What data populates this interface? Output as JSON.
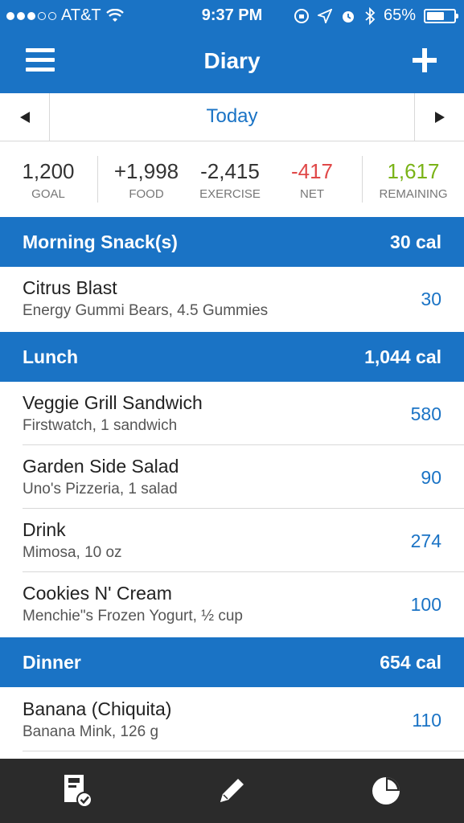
{
  "status_bar": {
    "carrier": "AT&T",
    "time": "9:37 PM",
    "battery": "65%",
    "battery_level": 0.65,
    "signal_bars": 3,
    "signal_total": 5,
    "icons": [
      "wifi-icon",
      "screen-rotation-lock-icon",
      "location-icon",
      "alarm-icon",
      "bluetooth-icon",
      "battery-icon"
    ]
  },
  "nav": {
    "title": "Diary",
    "left_icon": "hamburger-menu-icon",
    "right_icon": "plus-icon"
  },
  "date_bar": {
    "label": "Today"
  },
  "summary": {
    "goal": {
      "value": "1,200",
      "label": "GOAL"
    },
    "food": {
      "value": "+1,998",
      "label": "FOOD"
    },
    "exercise": {
      "value": "-2,415",
      "label": "EXERCISE"
    },
    "net": {
      "value": "-417",
      "label": "NET"
    },
    "remaining": {
      "value": "1,617",
      "label": "REMAINING"
    }
  },
  "sections": [
    {
      "title": "Morning Snack(s)",
      "total": "30 cal",
      "items": [
        {
          "name": "Citrus Blast",
          "desc": "Energy Gummi Bears, 4.5 Gummies",
          "cal": "30"
        }
      ]
    },
    {
      "title": "Lunch",
      "total": "1,044 cal",
      "items": [
        {
          "name": "Veggie Grill Sandwich",
          "desc": "Firstwatch, 1 sandwich",
          "cal": "580"
        },
        {
          "name": "Garden Side Salad",
          "desc": "Uno's Pizzeria, 1 salad",
          "cal": "90"
        },
        {
          "name": "Drink",
          "desc": "Mimosa, 10 oz",
          "cal": "274"
        },
        {
          "name": "Cookies N' Cream",
          "desc": "Menchie\"s Frozen Yogurt, ½ cup",
          "cal": "100"
        }
      ]
    },
    {
      "title": "Dinner",
      "total": "654 cal",
      "items": [
        {
          "name": "Banana (Chiquita)",
          "desc": "Banana Mink, 126 g",
          "cal": "110"
        }
      ]
    }
  ],
  "tab_bar": {
    "tabs": [
      "diary-checklist-icon",
      "pencil-icon",
      "pie-chart-icon"
    ]
  },
  "colors": {
    "brand_blue": "#1a73c5",
    "net_red": "#e04848",
    "remaining_green": "#7ab317",
    "tab_bar": "#2b2b2b"
  }
}
